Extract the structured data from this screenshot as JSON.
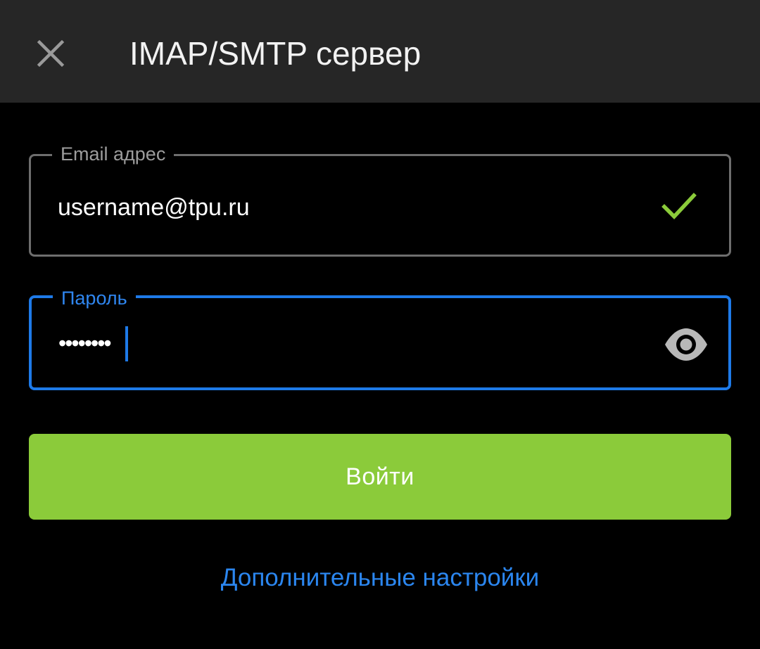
{
  "header": {
    "title": "IMAP/SMTP сервер",
    "close_icon": "close-icon"
  },
  "form": {
    "email": {
      "label": "Email адрес",
      "value": "username@tpu.ru",
      "valid_icon": "check-icon"
    },
    "password": {
      "label": "Пароль",
      "value": "••••••••",
      "toggle_icon": "eye-icon"
    },
    "submit_label": "Войти",
    "extra_settings_link": "Дополнительные настройки"
  },
  "colors": {
    "accent_green": "#8bcb3a",
    "accent_blue": "#1e7ae8",
    "header_bg": "#262626"
  }
}
